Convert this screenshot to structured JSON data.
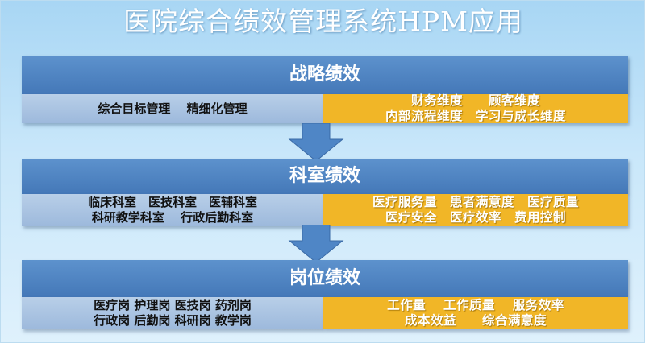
{
  "title": "医院综合绩效管理系统HPM应用",
  "levels": [
    {
      "title": "战略绩效",
      "left_lines": [
        "综合目标管理　 精细化管理"
      ],
      "right_lines": [
        "财务维度　　顾客维度",
        "内部流程维度　学习与成长维度"
      ]
    },
    {
      "title": "科室绩效",
      "left_lines": [
        "临床科室　医技科室　医辅科室",
        "科研教学科室　 行政后勤科室"
      ],
      "right_lines": [
        "医疗服务量　患者满意度　医疗质量",
        "医疗安全　医疗效率　费用控制"
      ]
    },
    {
      "title": "岗位绩效",
      "left_lines": [
        "医疗岗 护理岗 医技岗 药剂岗",
        "行政岗 后勤岗 科研岗 教学岗"
      ],
      "right_lines": [
        "工作量　 工作质量　 服务效率",
        "成本效益　　综合满意度"
      ]
    }
  ],
  "colors": {
    "background": "#c9e7fa",
    "header_blue": "#4f86c6",
    "left_panel": "#a9c3e2",
    "right_panel": "#f1b627",
    "arrow": "#4f86c6"
  }
}
